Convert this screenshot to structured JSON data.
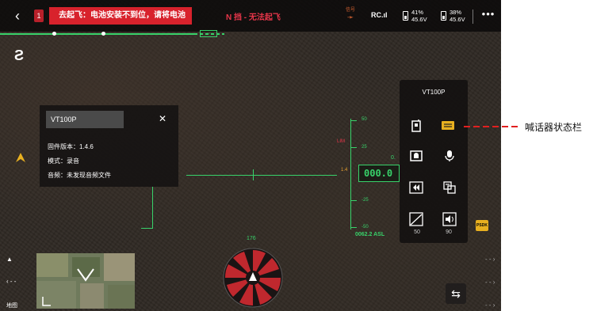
{
  "topbar": {
    "warning_count": "1",
    "warning_text": "去起飞：电池安装不到位，请将电池",
    "mode_status": "N 挡 - 无法起飞",
    "rc_signal_label": "信号",
    "rc_label": "RC.ıl",
    "battery1": {
      "percent": "41%",
      "voltage": "45.6V"
    },
    "battery2": {
      "percent": "38%",
      "voltage": "45.6V"
    },
    "more_label": "•••"
  },
  "info_panel": {
    "title": "VT100P",
    "firmware": "固件版本：1.4.6",
    "mode": "模式：录音",
    "audio": "音频：未发现音频文件"
  },
  "hud": {
    "lim_label": "LIM",
    "altitude": "000.0",
    "alt_right_value": "0.",
    "asl": "0062.2 ASL",
    "speed_indicator": "1.4",
    "heading": "176",
    "alt_ticks": [
      "50",
      "25",
      "-25",
      "-50"
    ]
  },
  "map": {
    "label": "地图"
  },
  "speaker_panel": {
    "title": "VT100P",
    "volume_value": "90",
    "brightness_value": "50",
    "icons": [
      "walkie-talkie-icon",
      "speaker-status-icon",
      "siren-icon",
      "microphone-icon",
      "rewind-icon",
      "text-to-speech-icon",
      "brightness-icon",
      "volume-icon"
    ]
  },
  "annotation": {
    "text": "喊话器状态栏"
  },
  "colors": {
    "hud_green": "#38d26a",
    "warning_red": "#d8222c",
    "accent_yellow": "#e8b020"
  }
}
